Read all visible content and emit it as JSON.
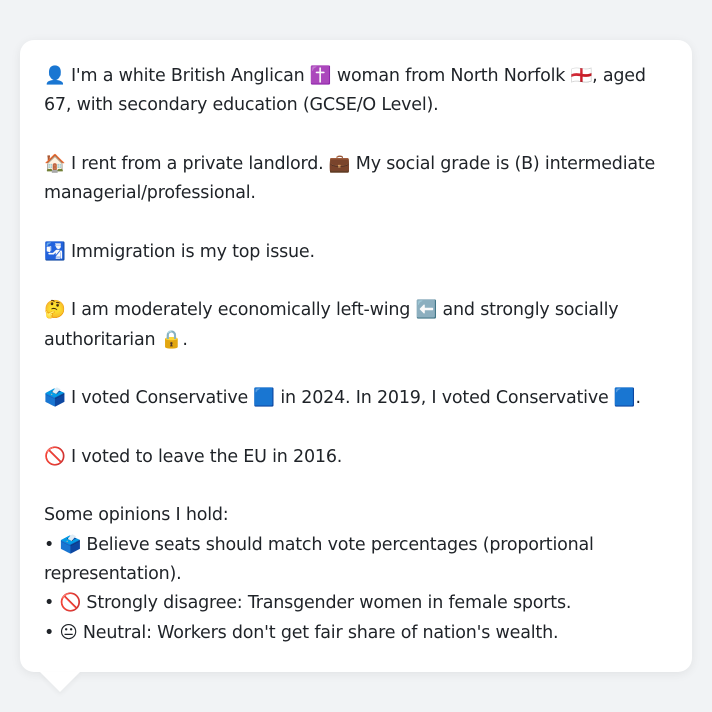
{
  "profile": {
    "identity_line": "👤 I'm a white British Anglican ✝️ woman from North Norfolk 🏴󠁧󠁢󠁥󠁮󠁧󠁿, aged 67, with secondary education (GCSE/O Level).",
    "housing_line": "🏠 I rent from a private landlord. 💼 My social grade is (B) intermediate managerial/professional.",
    "issue_line": "🛂 Immigration is my top issue.",
    "ideology_line": "🤔 I am moderately economically left-wing ⬅️ and strongly socially authoritarian 🔒.",
    "vote_line": "🗳️ I voted Conservative 🟦 in 2024. In 2019, I voted Conservative 🟦.",
    "eu_line": "🚫 I voted to leave the EU in 2016."
  },
  "opinions": {
    "heading": "Some opinions I hold:",
    "items": [
      "• 🗳️ Believe seats should match vote percentages (proportional representation).",
      "• 🚫 Strongly disagree: Transgender women in female sports.",
      "• 😐 Neutral: Workers don't get fair share of nation's wealth."
    ]
  }
}
